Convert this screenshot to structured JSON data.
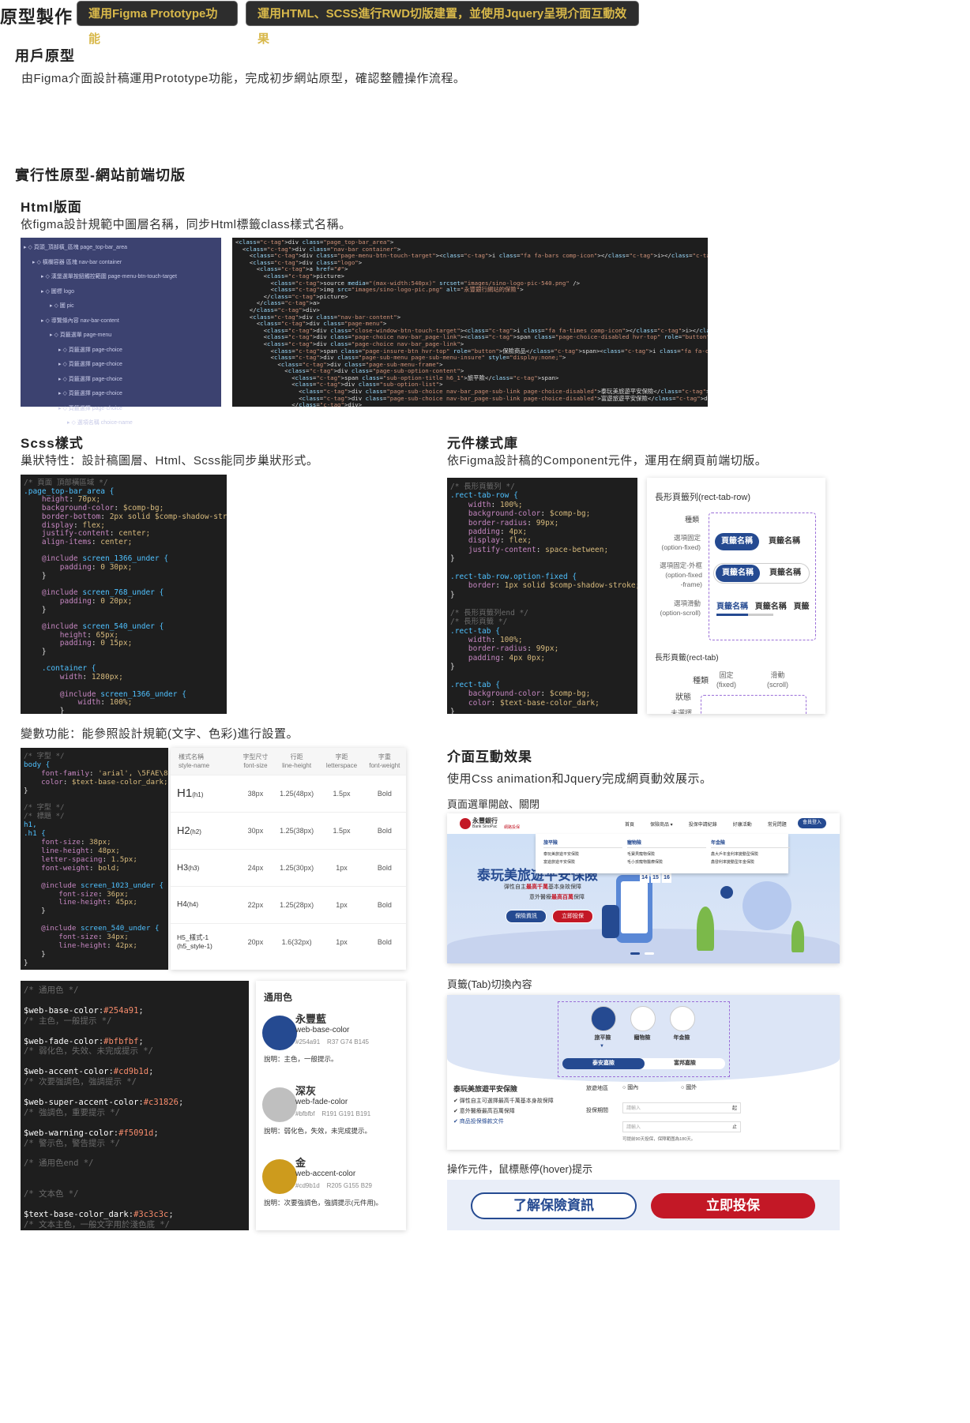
{
  "header": {
    "title": "原型製作",
    "tag1": "運用Figma Prototype功能",
    "tag2": "運用HTML、SCSS進行RWD切版建置，並使用Jquery呈現介面互動效果"
  },
  "prototype": {
    "heading": "用戶原型",
    "desc": "由Figma介面設計稿運用Prototype功能，完成初步網站原型，確認整體操作流程。"
  },
  "practical": {
    "heading": "實行性原型-網站前端切版"
  },
  "html_section": {
    "heading": "Html版面",
    "desc": "依figma設計規範中圖層名稱，同步Html標籤class樣式名稱。",
    "layers": [
      "頁頭_頂部橫_區塊 page_top-bar_area",
      "橫欄容器 區塊 nav-bar container",
      "漢堡選單按鈕觸控範圍 page-menu-btn-touch-target",
      "圖標 logo",
      "圖 pic",
      "導覽條內容 nav-bar-content",
      "頁籤選單 page-menu",
      "頁籤選擇 page-choice",
      "頁籤選擇 page-choice",
      "頁籤選擇 page-choice",
      "頁籤選擇 page-choice",
      "頁籤選擇 page-choice",
      "選項名稱 choice-name"
    ],
    "code_lines": [
      "<div class=\"page_top-bar_area\">",
      "  <div class=\"nav-bar container\">",
      "    <div class=\"page-menu-btn-touch-target\"><i class=\"fa fa-bars comp-icon\"></i></div>",
      "    <div class=\"logo\">",
      "      <a href=\"#\">",
      "        <picture>",
      "          <source media=\"(max-width:540px)\" srcset=\"images/sino-logo-pic-540.png\" />",
      "          <img src=\"images/sino-logo-pic.png\" alt=\"永豐銀行網站的保險\">",
      "        </picture>",
      "      </a>",
      "    </div>",
      "    <div class=\"nav-bar-content\">",
      "      <div class=\"page-menu\">",
      "        <div class=\"close-window-btn-touch-target\"><i class=\"fa fa-times comp-icon\"></i></div>",
      "        <div class=\"page-choice nav-bar_page-link\"><span class=\"page-choice-disabled hvr-top\" role=\"button\">首頁</span></div>",
      "        <div class=\"page-choice nav-bar_page-link\">",
      "          <span class=\"page-insure-btn hvr-top\" role=\"button\">保險商品</span><i class=\"fa fa-caret-down comp-icon\"></i>",
      "          <div class=\"page-sub-menu page-sub-menu-insure\" style=\"display:none;\">",
      "            <div class=\"page-sub-menu-frame\">",
      "              <div class=\"page-sub-option-content\">",
      "                <span class=\"sub-option-title h6_1\">旅平險</span>",
      "                <div class=\"sub-option-list\">",
      "                  <div class=\"page-sub-choice nav-bar_page-sub-link page-choice-disabled\">泰玩美旅遊平安保險</div>",
      "                  <div class=\"page-sub-choice nav-bar_page-sub-link page-choice-disabled\">富遊旅遊平安保險</div>",
      "                </div>"
    ]
  },
  "scss_section": {
    "heading": "Scss樣式",
    "desc": "巢狀特性：設計稿圖層、Html、Scss能同步巢狀形式。",
    "code_lines": [
      "/* 頁面 頂部橫區域 */",
      ".page_top-bar_area {",
      "    height: 70px;",
      "    background-color: $comp-bg;",
      "    border-bottom: 2px solid $comp-shadow-stroke;",
      "    display: flex;",
      "    justify-content: center;",
      "    align-items: center;",
      "",
      "    @include screen_1366_under {",
      "        padding: 0 30px;",
      "    }",
      "",
      "    @include screen_768_under {",
      "        padding: 0 20px;",
      "    }",
      "",
      "    @include screen_540_under {",
      "        height: 65px;",
      "        padding: 0 15px;",
      "    }",
      "",
      "    .container {",
      "        width: 1280px;",
      "",
      "        @include screen_1366_under {",
      "            width: 100%;",
      "        }"
    ]
  },
  "component_section": {
    "heading": "元件樣式庫",
    "desc": "依Figma設計稿的Component元件，運用在網頁前端切版。",
    "code_lines": [
      "/* 長形頁籤列 */",
      ".rect-tab-row {",
      "    width: 100%;",
      "    background-color: $comp-bg;",
      "    border-radius: 99px;",
      "    padding: 4px;",
      "    display: flex;",
      "    justify-content: space-between;",
      "}",
      "",
      ".rect-tab-row.option-fixed {",
      "    border: 1px solid $comp-shadow-stroke;",
      "}",
      "",
      "/* 長形頁籤列end */",
      "/* 長形頁籤 */",
      ".rect-tab {",
      "    width: 100%;",
      "    border-radius: 99px;",
      "    padding: 4px 0px;",
      "}",
      "",
      ".rect-tab {",
      "    background-color: $comp-bg;",
      "    color: $text-base-color_dark;",
      "}"
    ],
    "panel_title1": "長形頁籤列(rect-tab-row)",
    "kind_label": "種類",
    "opt1": "選項固定",
    "opt1_sub": "(option-fixed)",
    "opt2": "選項固定-外框",
    "opt2_sub": "(option-fixed",
    "opt2_sub2": "-frame)",
    "opt3": "選項滑動",
    "opt3_sub": "(option-scroll)",
    "tab_active": "頁籤名稱",
    "tab_other": "頁籤名稱",
    "tab_cut": "頁籤",
    "panel_title2": "長形頁籤(rect-tab)",
    "kind2": "種類",
    "fixed": "固定",
    "fixed_sub": "(fixed)",
    "scroll": "滑動",
    "scroll_sub": "(scroll)",
    "state": "狀態",
    "cut_text": "未選擇"
  },
  "variable_section": {
    "desc": "變數功能：能參照設計規範(文字、色彩)進行設置。",
    "type_code": [
      "/* 字型 */",
      "body {",
      "    font-family: 'arial', \\5FAE\\8",
      "    color: $text-base-color_dark;",
      "}",
      "",
      "/* 字型 */",
      "/* 標題 */",
      "h1,",
      ".h1 {",
      "    font-size: 38px;",
      "    line-height: 48px;",
      "    letter-spacing: 1.5px;",
      "    font-weight: bold;",
      "",
      "    @include screen_1023_under {",
      "        font-size: 36px;",
      "        line-height: 45px;",
      "    }",
      "",
      "    @include screen_540_under {",
      "        font-size: 34px;",
      "        line-height: 42px;",
      "    }",
      "}"
    ],
    "type_headers": [
      "樣式名稱\nstyle-name",
      "字型尺寸\nfont-size",
      "行距\nline-height",
      "字距\nletterspace",
      "字重\nfont-weight"
    ],
    "type_rows": [
      {
        "name": "H1",
        "sub": "(h1)",
        "size": "38px",
        "lh": "1.25(48px)",
        "ls": "1.5px",
        "w": "Bold"
      },
      {
        "name": "H2",
        "sub": "(h2)",
        "size": "30px",
        "lh": "1.25(38px)",
        "ls": "1.5px",
        "w": "Bold"
      },
      {
        "name": "H3",
        "sub": "(h3)",
        "size": "24px",
        "lh": "1.25(30px)",
        "ls": "1px",
        "w": "Bold"
      },
      {
        "name": "H4",
        "sub": "(h4)",
        "size": "22px",
        "lh": "1.25(28px)",
        "ls": "1px",
        "w": "Bold"
      },
      {
        "name": "H5_樣式-1",
        "sub": "(h5_style-1)",
        "size": "20px",
        "lh": "1.6(32px)",
        "ls": "1px",
        "w": "Bold"
      }
    ],
    "color_code": [
      "/* 通用色 */",
      "",
      "$web-base-color:#254a91;",
      "/* 主色，一般提示 */",
      "",
      "$web-fade-color:#bfbfbf;",
      "/* 弱化色，失效、未完成提示 */",
      "",
      "$web-accent-color:#cd9b1d;",
      "/* 次要強調色，強調提示 */",
      "",
      "$web-super-accent-color:#c31826;",
      "/* 強調色，重要提示 */",
      "",
      "$web-warning-color:#f5091d;",
      "/* 警示色，警告提示 */",
      "",
      "/* 通用色end */",
      "",
      "",
      "/* 文本色 */",
      "",
      "$text-base-color_dark:#3c3c3c;",
      "/* 文本主色，一般文字用於淺色底 */"
    ],
    "colors_title": "通用色",
    "colors": [
      {
        "name": "永豐藍",
        "var": "web-base-color",
        "hex": "#254a91",
        "rgb": "R37 G74 B145",
        "note": "說明：主色，一般提示。",
        "color": "#254a91"
      },
      {
        "name": "深灰",
        "var": "web-fade-color",
        "hex": "#bfbfbf",
        "rgb": "R191 G191 B191",
        "note": "說明：弱化色，失效，未完成提示。",
        "color": "#bfbfbf"
      },
      {
        "name": "金",
        "var": "web-accent-color",
        "hex": "#cd9b1d",
        "rgb": "R205 G155 B29",
        "note": "說明：次要強調色，強調提示(元件用)。",
        "color": "#cd9b1d"
      }
    ]
  },
  "interaction_section": {
    "heading": "介面互動效果",
    "desc": "使用Css animation和Jquery完成網頁動效展示。",
    "menu_label": "頁面選單開啟、關閉",
    "nav_items": [
      "首頁",
      "保險商品 ▾",
      "投保申請紀錄",
      "好康活動",
      "常見問題"
    ],
    "login": "會員登入",
    "bank_name": "永豐銀行",
    "bank_sub": "Bank SinoPac",
    "bank_tag": "網路投保",
    "dropdown": [
      {
        "title": "旅平險",
        "items": [
          "泰玩美旅遊平安保險",
          "富遊旅遊平安保險"
        ]
      },
      {
        "title": "寵物險",
        "items": [
          "毛寶貝寵物保險",
          "毛小孩寵物醫療保險"
        ]
      },
      {
        "title": "年金險",
        "items": [
          "鑫大戶年金利率變動型保險",
          "鑫發利率變動型年金保險"
        ]
      }
    ],
    "hero_title": "泰玩美旅遊平安保險",
    "hero_l1a": "彈性自主",
    "hero_l1b": "最高千萬",
    "hero_l1c": "基本身故保障",
    "hero_l2a": "意外醫療",
    "hero_l2b": "最高百萬",
    "hero_l2c": "保障",
    "hero_btn1": "保險資訊",
    "hero_btn2": "立即投保",
    "calendar": [
      "14",
      "15",
      "16"
    ],
    "tab_label": "頁籤(Tab)切換內容",
    "tab_icons": [
      {
        "name": "旅平險"
      },
      {
        "name": "寵物險"
      },
      {
        "name": "年金險"
      }
    ],
    "sub_tabs": [
      "泰安嘉險",
      "富邦嘉險"
    ],
    "product_title": "泰玩美旅遊平安保險",
    "product_pts": [
      "彈性自主可選擇最高千萬基本身故保障",
      "意外醫療最高百萬保障",
      "商品投保條款文件"
    ],
    "form_dest": "旅遊地區",
    "form_in": "國內",
    "form_out": "國外",
    "form_period": "投保期間",
    "form_ph": "請輸入",
    "form_start": "起",
    "form_end": "止",
    "form_note": "可提前90天投保，保障範圍為180天。",
    "hover_label": "操作元件，鼠標懸停(hover)提示",
    "btn_info": "了解保險資訊",
    "btn_buy": "立即投保"
  }
}
